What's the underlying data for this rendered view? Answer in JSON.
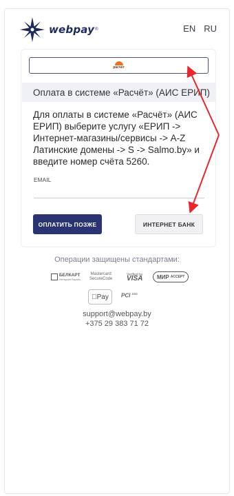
{
  "header": {
    "logo_text": "webpay",
    "logo_mark": "®",
    "languages": [
      "EN",
      "RU"
    ]
  },
  "payment": {
    "method_logo_text": "расчет",
    "section_title": "Оплата в системе «Расчёт» (АИС ЕРИП)",
    "instructions": "Для оплаты в системе «Расчёт» (АИС ЕРИП) выберите услугу «ЕРИП -> Интернет-магазины/сервисы -> A-Z Латинские домены -> S -> Salmo.by» и введите номер счёта 5260.",
    "email_label": "EMAIL",
    "email_value": "",
    "pay_later_label": "ОПЛАТИТЬ ПОЗЖЕ",
    "internet_bank_label": "ИНТЕРНЕТ БАНК"
  },
  "footer": {
    "secured_text": "Операции защищены стандартами:",
    "badges": {
      "belkart": "БЕЛКАРТ",
      "belkart_sub": "ИнтернетПароль",
      "mastercard_line1": "Mastercard",
      "mastercard_line2": "SecureCode",
      "visa_line1": "Verified by",
      "visa_line2": "VISA",
      "mir": "МИР",
      "mir_sub": "ACCEPT",
      "apple_pay": "Pay",
      "pci": "PCI",
      "pci_sub": "DSS"
    },
    "support_email": "support@webpay.by",
    "support_phone": "+375 29 383 71 72"
  },
  "colors": {
    "primary_button": "#2a3472",
    "annotation_arrow": "#e8262b",
    "logo": "#1f2a5c"
  }
}
